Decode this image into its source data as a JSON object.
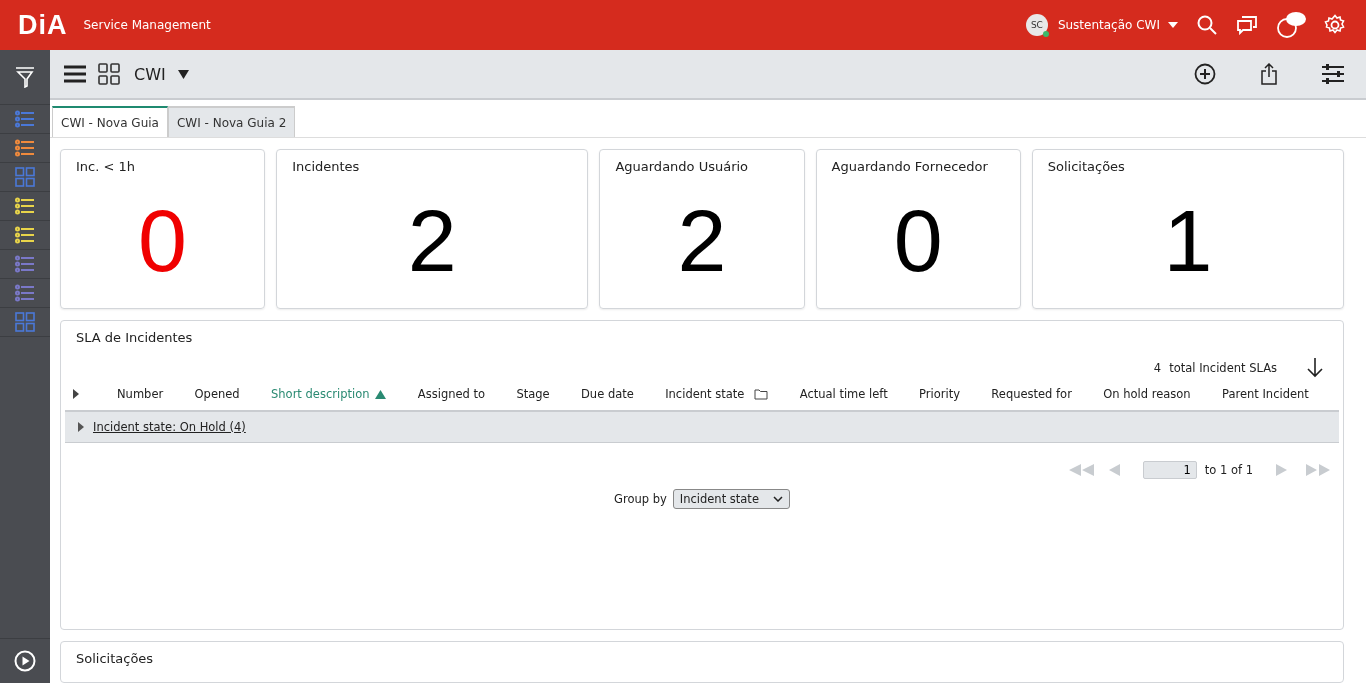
{
  "header": {
    "logo": "DiA",
    "product": "Service Management",
    "user_initials": "SC",
    "user_name": "Sustentação CWI",
    "user_online": true
  },
  "sidebar": {
    "items": [
      {
        "kind": "list",
        "color": "#4a78d8"
      },
      {
        "kind": "list",
        "color": "#f08a3c"
      },
      {
        "kind": "grid",
        "color": "#4a78d8"
      },
      {
        "kind": "list",
        "color": "#e8d44a"
      },
      {
        "kind": "list",
        "color": "#e8d44a"
      },
      {
        "kind": "list",
        "color": "#7a78c8"
      },
      {
        "kind": "list",
        "color": "#7a78c8"
      },
      {
        "kind": "grid",
        "color": "#4a78d8"
      }
    ]
  },
  "toolbar": {
    "dashboard": "CWI"
  },
  "tabs": [
    {
      "label": "CWI - Nova Guia",
      "selected": true
    },
    {
      "label": "CWI - Nova Guia 2",
      "selected": false
    }
  ],
  "cards": [
    {
      "title": "Inc. < 1h",
      "value": "0",
      "alert": true
    },
    {
      "title": "Incidentes",
      "value": "2",
      "alert": false
    },
    {
      "title": "Aguardando Usuário",
      "value": "2",
      "alert": false
    },
    {
      "title": "Aguardando Fornecedor",
      "value": "0",
      "alert": false
    },
    {
      "title": "Solicitações",
      "value": "1",
      "alert": false
    }
  ],
  "sla": {
    "title": "SLA de Incidentes",
    "total_count": "4",
    "total_label": "total Incident SLAs",
    "columns": [
      {
        "label": "Number",
        "sorted": false,
        "grouped": false
      },
      {
        "label": "Opened",
        "sorted": false,
        "grouped": false
      },
      {
        "label": "Short description",
        "sorted": true,
        "grouped": false
      },
      {
        "label": "Assigned to",
        "sorted": false,
        "grouped": false
      },
      {
        "label": "Stage",
        "sorted": false,
        "grouped": false
      },
      {
        "label": "Due date",
        "sorted": false,
        "grouped": false
      },
      {
        "label": "Incident state",
        "sorted": false,
        "grouped": true
      },
      {
        "label": "Actual time left",
        "sorted": false,
        "grouped": false
      },
      {
        "label": "Priority",
        "sorted": false,
        "grouped": false
      },
      {
        "label": "Requested for",
        "sorted": false,
        "grouped": false
      },
      {
        "label": "On hold reason",
        "sorted": false,
        "grouped": false
      },
      {
        "label": "Parent Incident",
        "sorted": false,
        "grouped": false
      }
    ],
    "groups": [
      {
        "label": "Incident state: On Hold (4)",
        "expanded": false
      }
    ],
    "page": "1",
    "page_range": "to 1 of 1",
    "group_by_label": "Group by",
    "group_by": "Incident state"
  },
  "next_panel": {
    "title": "Solicitações"
  }
}
